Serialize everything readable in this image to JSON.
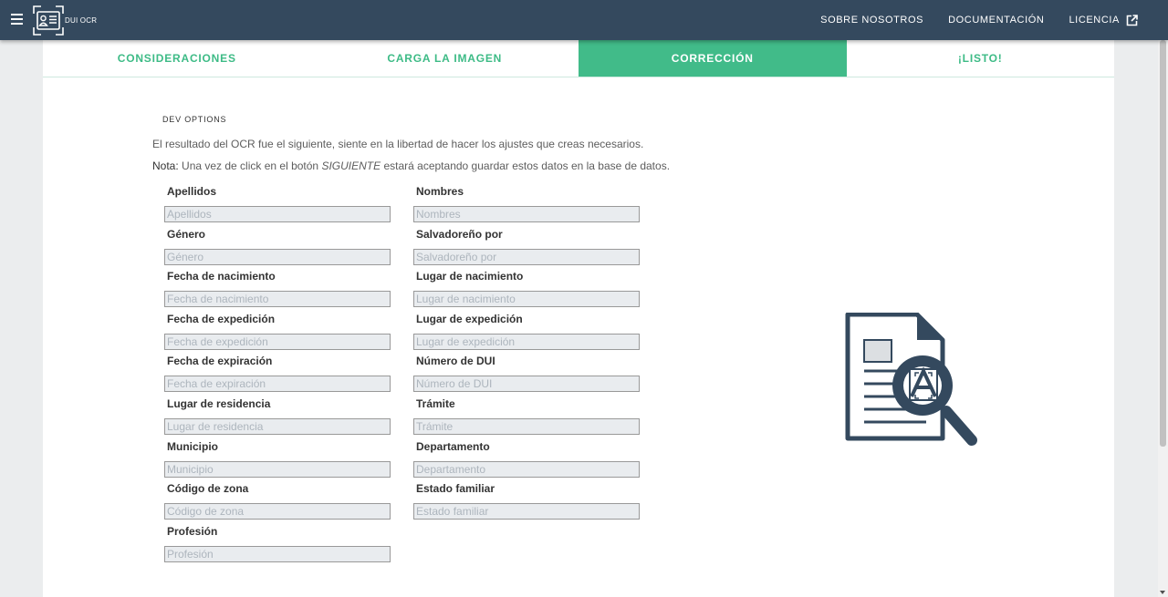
{
  "header": {
    "logo_text": "DUI OCR",
    "nav": [
      {
        "label": "SOBRE NOSOTROS"
      },
      {
        "label": "DOCUMENTACIÓN"
      },
      {
        "label": "LICENCIA",
        "icon": "open-in-new-icon"
      }
    ]
  },
  "tabs": [
    {
      "label": "CONSIDERACIONES",
      "active": false
    },
    {
      "label": "CARGA LA IMAGEN",
      "active": false
    },
    {
      "label": "CORRECCIÓN",
      "active": true
    },
    {
      "label": "¡LISTO!",
      "active": false
    }
  ],
  "dev_options": "DEV OPTIONS",
  "intro": "El resultado del OCR fue el siguiente, siente en la libertad de hacer los ajustes que creas necesarios.",
  "note": {
    "label": "Nota:",
    "before": " Una vez de click en el botón ",
    "emphasis": "SIGUIENTE",
    "after": " estará aceptando guardar estos datos en la base de datos."
  },
  "fields": {
    "apellidos": {
      "label": "Apellidos",
      "placeholder": "Apellidos",
      "value": ""
    },
    "nombres": {
      "label": "Nombres",
      "placeholder": "Nombres",
      "value": ""
    },
    "genero": {
      "label": "Género",
      "placeholder": "Género",
      "value": ""
    },
    "salvadoreno_por": {
      "label": "Salvadoreño por",
      "placeholder": "Salvadoreño por",
      "value": ""
    },
    "fecha_nacimiento": {
      "label": "Fecha de nacimiento",
      "placeholder": "Fecha de nacimiento",
      "value": ""
    },
    "lugar_nacimiento": {
      "label": "Lugar de nacimiento",
      "placeholder": "Lugar de nacimiento",
      "value": ""
    },
    "fecha_expedicion": {
      "label": "Fecha de expedición",
      "placeholder": "Fecha de expedición",
      "value": ""
    },
    "lugar_expedicion": {
      "label": "Lugar de expedición",
      "placeholder": "Lugar de expedición",
      "value": ""
    },
    "fecha_expiracion": {
      "label": "Fecha de expiración",
      "placeholder": "Fecha de expiración",
      "value": ""
    },
    "numero_dui": {
      "label": "Número de DUI",
      "placeholder": "Número de DUI",
      "value": ""
    },
    "lugar_residencia": {
      "label": "Lugar de residencia",
      "placeholder": "Lugar de residencia",
      "value": ""
    },
    "tramite": {
      "label": "Trámite",
      "placeholder": "Trámite",
      "value": ""
    },
    "municipio": {
      "label": "Municipio",
      "placeholder": "Municipio",
      "value": ""
    },
    "departamento": {
      "label": "Departamento",
      "placeholder": "Departamento",
      "value": ""
    },
    "codigo_zona": {
      "label": "Código de zona",
      "placeholder": "Código de zona",
      "value": ""
    },
    "estado_familiar": {
      "label": "Estado familiar",
      "placeholder": "Estado familiar",
      "value": ""
    },
    "profesion": {
      "label": "Profesión",
      "placeholder": "Profesión",
      "value": ""
    }
  },
  "colors": {
    "header_bg": "#34495e",
    "accent": "#41bb89",
    "illustration": "#34495e"
  },
  "illustration_icon": "document-search-icon"
}
